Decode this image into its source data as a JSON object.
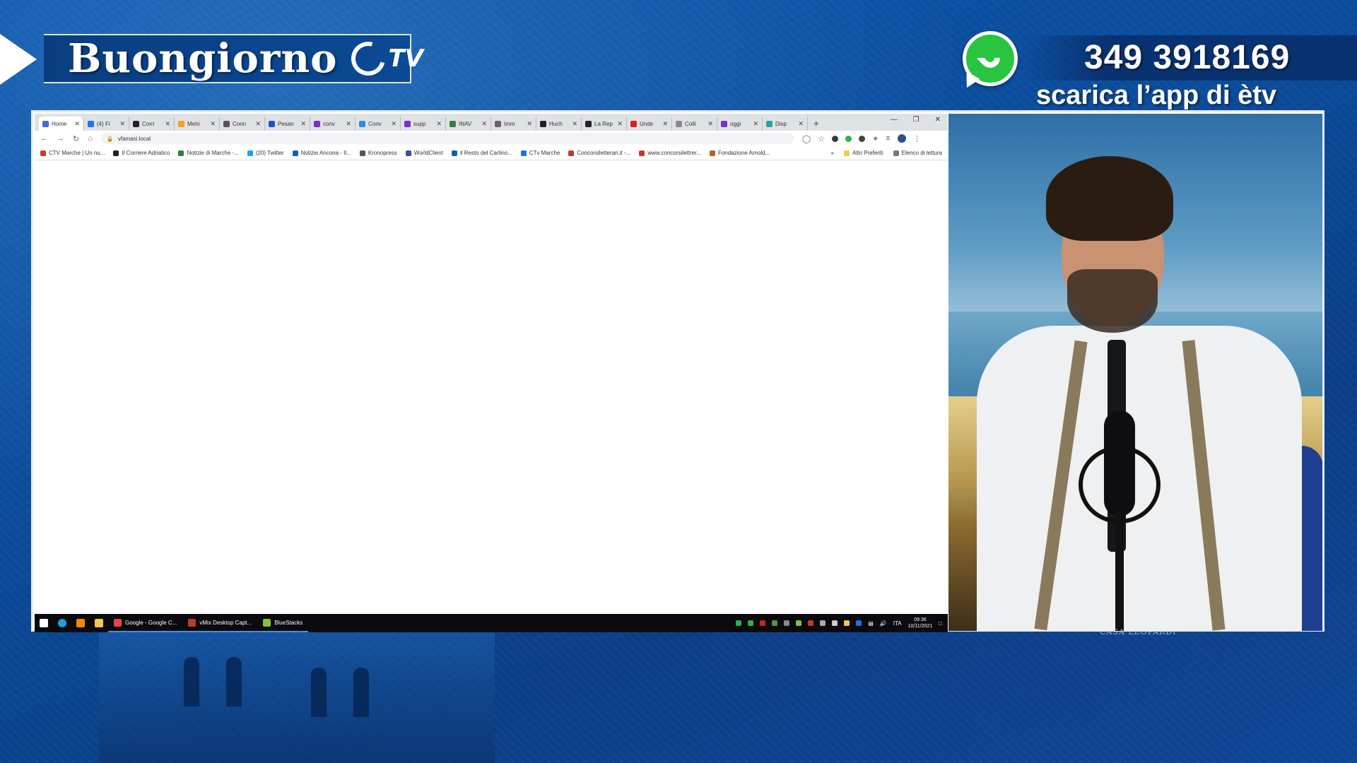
{
  "overlay": {
    "show_title": "Buongiorno",
    "logo_tv": "TV",
    "phone_number": "349 3918169",
    "app_text": "scarica l’app di ètv",
    "icons": [
      "play-arrow-icon",
      "etv-logo-icon",
      "whatsapp-icon"
    ],
    "colors": {
      "background": "#0b4fa0",
      "band": "#093d80",
      "whatsapp": "#29c541"
    }
  },
  "browser": {
    "tabs": [
      {
        "label": "Home",
        "fav": "#3b6fd8",
        "active": true
      },
      {
        "label": "(4) Fi",
        "fav": "#1877f2"
      },
      {
        "label": "Corri",
        "fav": "#222222"
      },
      {
        "label": "Mehi",
        "fav": "#f4a020"
      },
      {
        "label": "Conn",
        "fav": "#555555"
      },
      {
        "label": "Pesan",
        "fav": "#1a56c9"
      },
      {
        "label": "conv",
        "fav": "#7b2fc4"
      },
      {
        "label": "Conv",
        "fav": "#2c8fd6"
      },
      {
        "label": "supp",
        "fav": "#7b2fc4"
      },
      {
        "label": "INAV",
        "fav": "#3a7d44"
      },
      {
        "label": "Imm",
        "fav": "#666666"
      },
      {
        "label": "Huch",
        "fav": "#222222"
      },
      {
        "label": "La Rep",
        "fav": "#222222"
      },
      {
        "label": "Unde",
        "fav": "#d62020"
      },
      {
        "label": "Colli",
        "fav": "#888888"
      },
      {
        "label": "oggi",
        "fav": "#7b2fc4"
      },
      {
        "label": "Disp",
        "fav": "#2aa3a3"
      }
    ],
    "new_tab": "+",
    "url": "vfamasi.local",
    "bookmarks": [
      {
        "label": "CTV Marche | Un nu...",
        "fav": "#c83a2a"
      },
      {
        "label": "Il Corriere Adriatico",
        "fav": "#222222"
      },
      {
        "label": "Notizie di Marche -...",
        "fav": "#2d7d3a"
      },
      {
        "label": "(20) Twitter",
        "fav": "#1da1f2"
      },
      {
        "label": "Notizie Ancona - Il...",
        "fav": "#1a56c9"
      },
      {
        "label": "Kronopress",
        "fav": "#555555"
      },
      {
        "label": "WorldClient",
        "fav": "#3a4fa0"
      },
      {
        "label": "il Resto del Carlino...",
        "fav": "#1a56c9"
      },
      {
        "label": "CTv Marche",
        "fav": "#1a73e8"
      },
      {
        "label": "Concorsiletterari.it -...",
        "fav": "#c0392b"
      },
      {
        "label": "www.concorsilettrer...",
        "fav": "#c0392b"
      },
      {
        "label": "Fondazione Arnold...",
        "fav": "#b5651d"
      }
    ],
    "bookmarks_more": "»",
    "other_favorites": "Altri Preferiti",
    "reading_list": "Elenco di lettura"
  },
  "taskbar": {
    "apps": [
      {
        "label": "Google - Google C...",
        "color": "#e8453c"
      },
      {
        "label": "vMix Desktop Capt...",
        "color": "#c0392b"
      },
      {
        "label": "BlueStacks",
        "color": "#7fc241"
      }
    ],
    "language": "ITA",
    "time": "09:36",
    "date": "10/11/2021"
  },
  "scene": {
    "wall_sign": "CASA LEOPARDI"
  }
}
